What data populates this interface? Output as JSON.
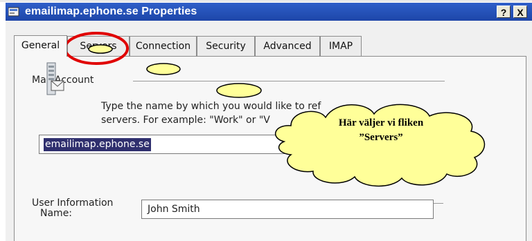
{
  "window": {
    "title": "emailimap.ephone.se Properties",
    "help_label": "?",
    "close_label": "X"
  },
  "tabs": [
    {
      "label": "General",
      "active": true
    },
    {
      "label": "Servers",
      "active": false
    },
    {
      "label": "Connection",
      "active": false
    },
    {
      "label": "Security",
      "active": false
    },
    {
      "label": "Advanced",
      "active": false
    },
    {
      "label": "IMAP",
      "active": false
    }
  ],
  "general": {
    "mail_account_heading": "Mail Account",
    "description_line1": "Type the name by which you would like to ref",
    "description_line2": "servers.  For example: \"Work\" or \"V",
    "account_name_value": "emailimap.ephone.se",
    "user_info_heading": "User Information",
    "name_label": "Name:",
    "name_value": "John Smith"
  },
  "annotation": {
    "callout_line1": "Här väljer vi fliken",
    "callout_line2": "”Servers”",
    "highlight_color": "#e00000",
    "cloud_fill": "#ffff99"
  }
}
